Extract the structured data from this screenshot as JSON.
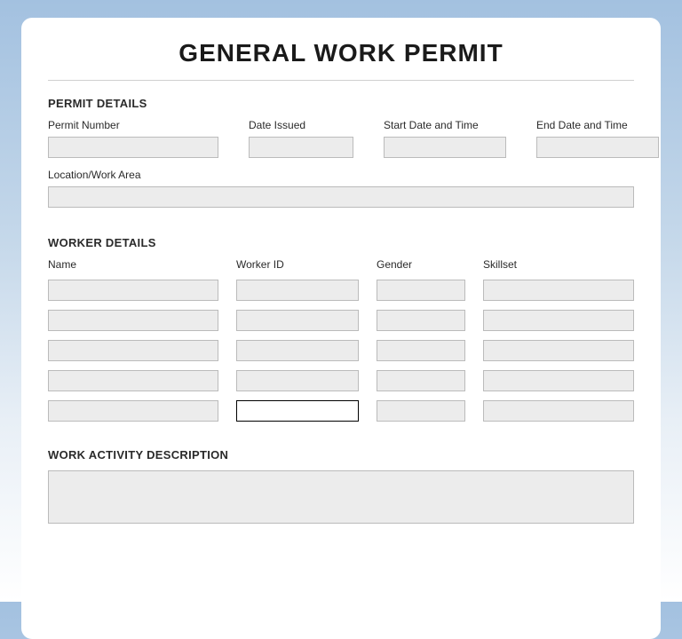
{
  "title": "GENERAL WORK PERMIT",
  "sections": {
    "permit": {
      "header": "PERMIT DETAILS",
      "fields": {
        "permit_number": {
          "label": "Permit Number",
          "value": ""
        },
        "date_issued": {
          "label": "Date Issued",
          "value": ""
        },
        "start": {
          "label": "Start Date and Time",
          "value": ""
        },
        "end": {
          "label": "End Date and Time",
          "value": ""
        },
        "location": {
          "label": "Location/Work Area",
          "value": ""
        }
      }
    },
    "workers": {
      "header": "WORKER DETAILS",
      "columns": {
        "name": "Name",
        "id": "Worker ID",
        "gender": "Gender",
        "skill": "Skillset"
      },
      "rows": [
        {
          "name": "",
          "id": "",
          "gender": "",
          "skill": ""
        },
        {
          "name": "",
          "id": "",
          "gender": "",
          "skill": ""
        },
        {
          "name": "",
          "id": "",
          "gender": "",
          "skill": ""
        },
        {
          "name": "",
          "id": "",
          "gender": "",
          "skill": ""
        },
        {
          "name": "",
          "id": "",
          "gender": "",
          "skill": ""
        }
      ]
    },
    "activity": {
      "header": "WORK ACTIVITY DESCRIPTION",
      "value": ""
    }
  }
}
